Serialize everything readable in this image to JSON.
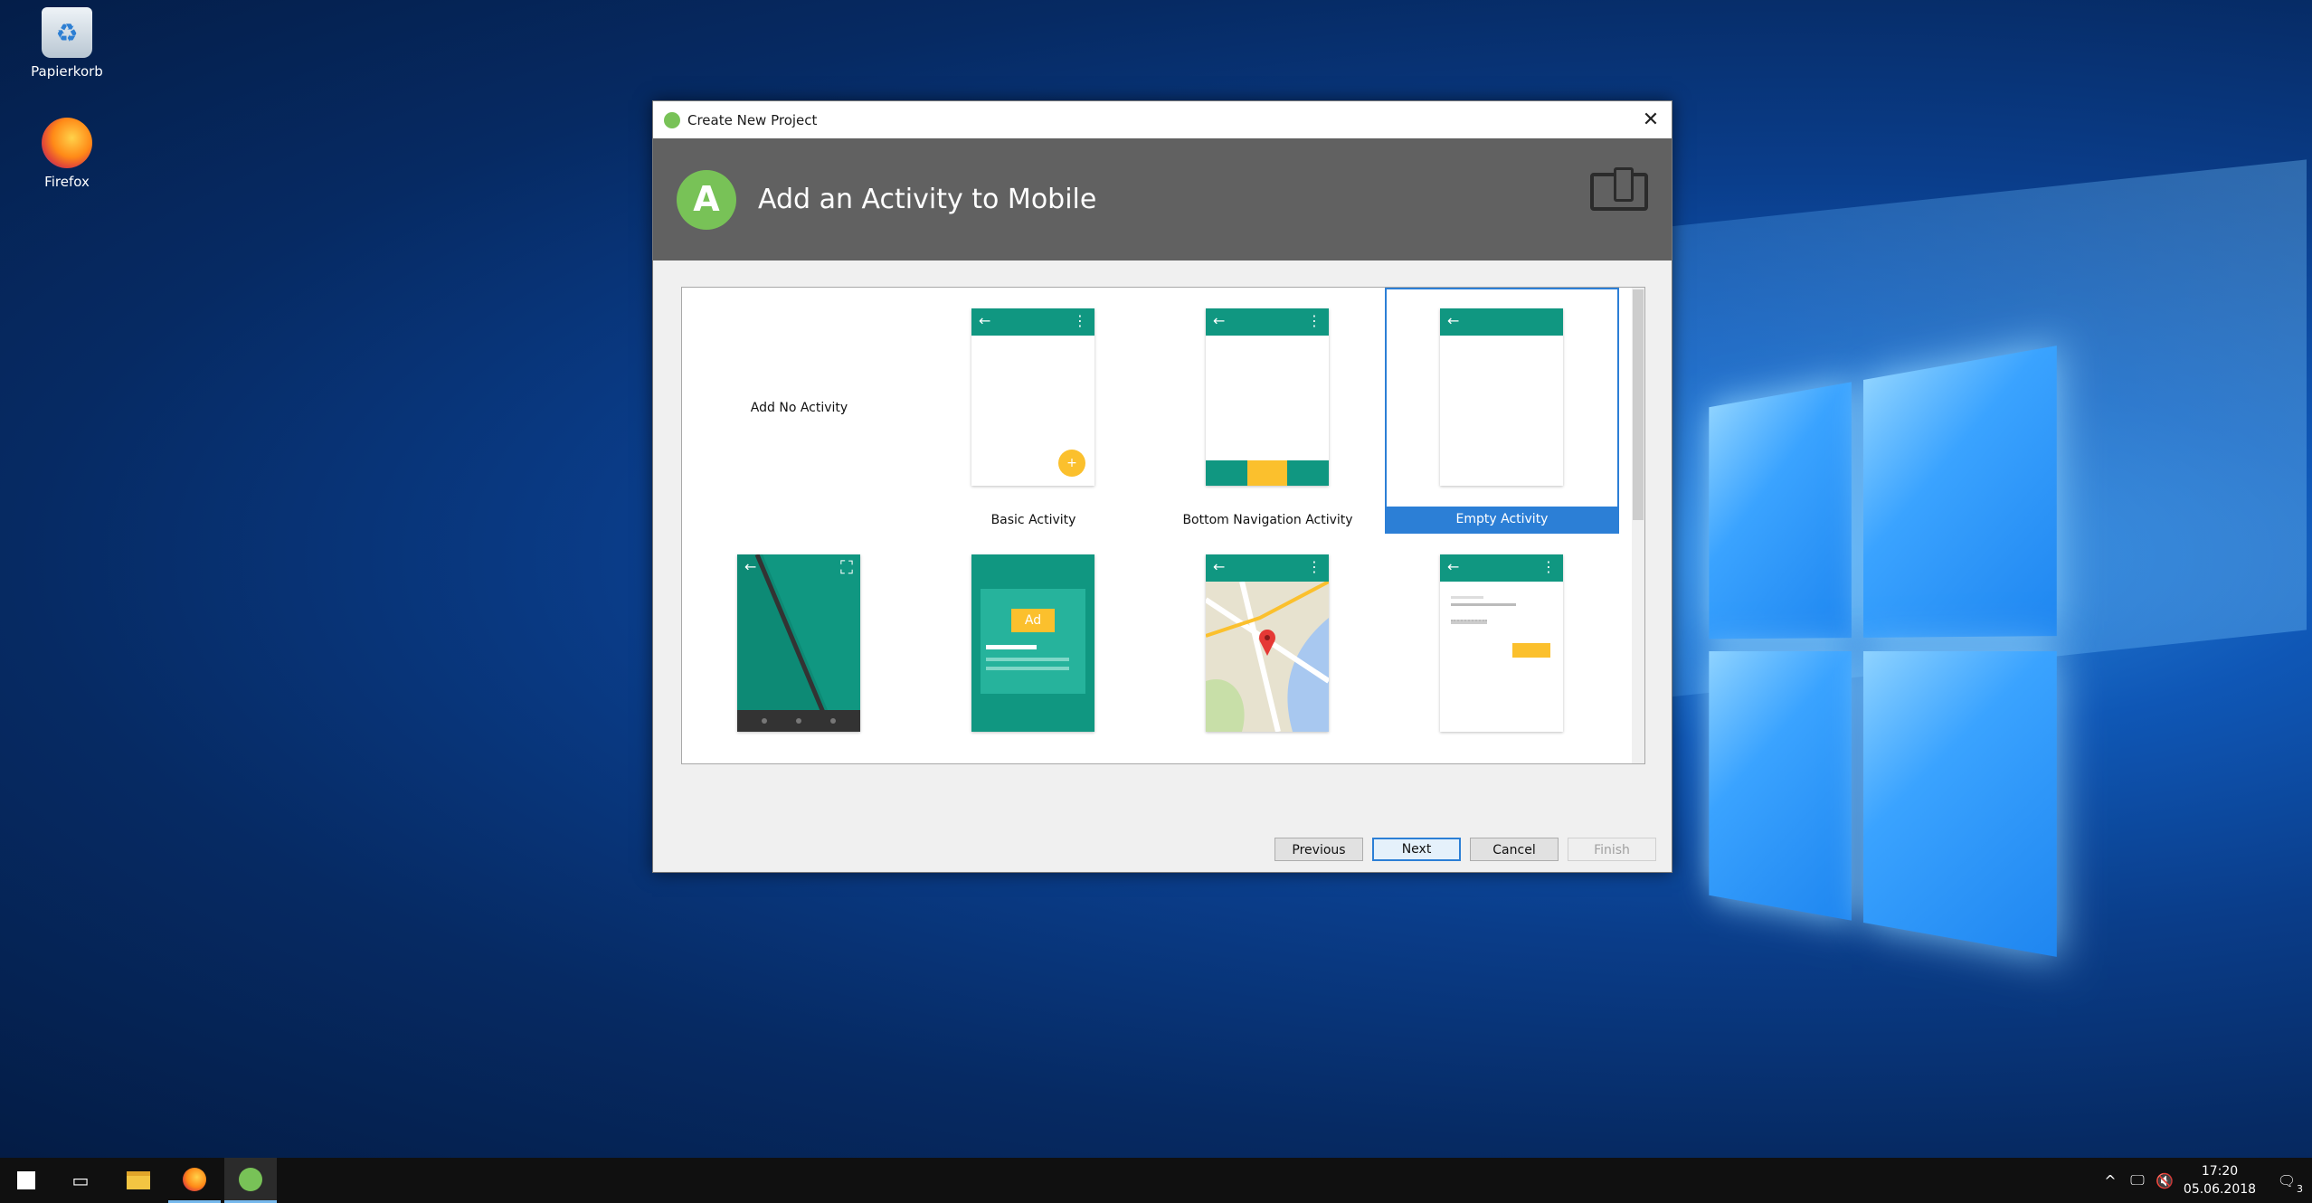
{
  "desktop": {
    "icons": [
      {
        "label": "Papierkorb",
        "icon": "recycle-bin-icon"
      },
      {
        "label": "Firefox",
        "icon": "firefox-icon"
      }
    ]
  },
  "dialog": {
    "window_title": "Create New Project",
    "close_glyph": "✕",
    "banner_title": "Add an Activity to Mobile",
    "templates": [
      {
        "label": "Add No Activity",
        "selected": false
      },
      {
        "label": "Basic Activity",
        "selected": false
      },
      {
        "label": "Bottom Navigation Activity",
        "selected": false
      },
      {
        "label": "Empty Activity",
        "selected": true
      },
      {
        "label": "",
        "preview": "fullscreen-activity"
      },
      {
        "label": "",
        "preview": "google-admob-ads-activity"
      },
      {
        "label": "",
        "preview": "google-maps-activity"
      },
      {
        "label": "",
        "preview": "login-activity"
      }
    ],
    "ad_label": "Ad",
    "buttons": {
      "previous": "Previous",
      "next": "Next",
      "cancel": "Cancel",
      "finish": "Finish"
    },
    "colors": {
      "teal": "#109781",
      "amber": "#fbc02d",
      "selection": "#2c7fd6",
      "banner": "#616161"
    }
  },
  "taskbar": {
    "time": "17:20",
    "date": "05.06.2018",
    "notification_count": "3"
  }
}
